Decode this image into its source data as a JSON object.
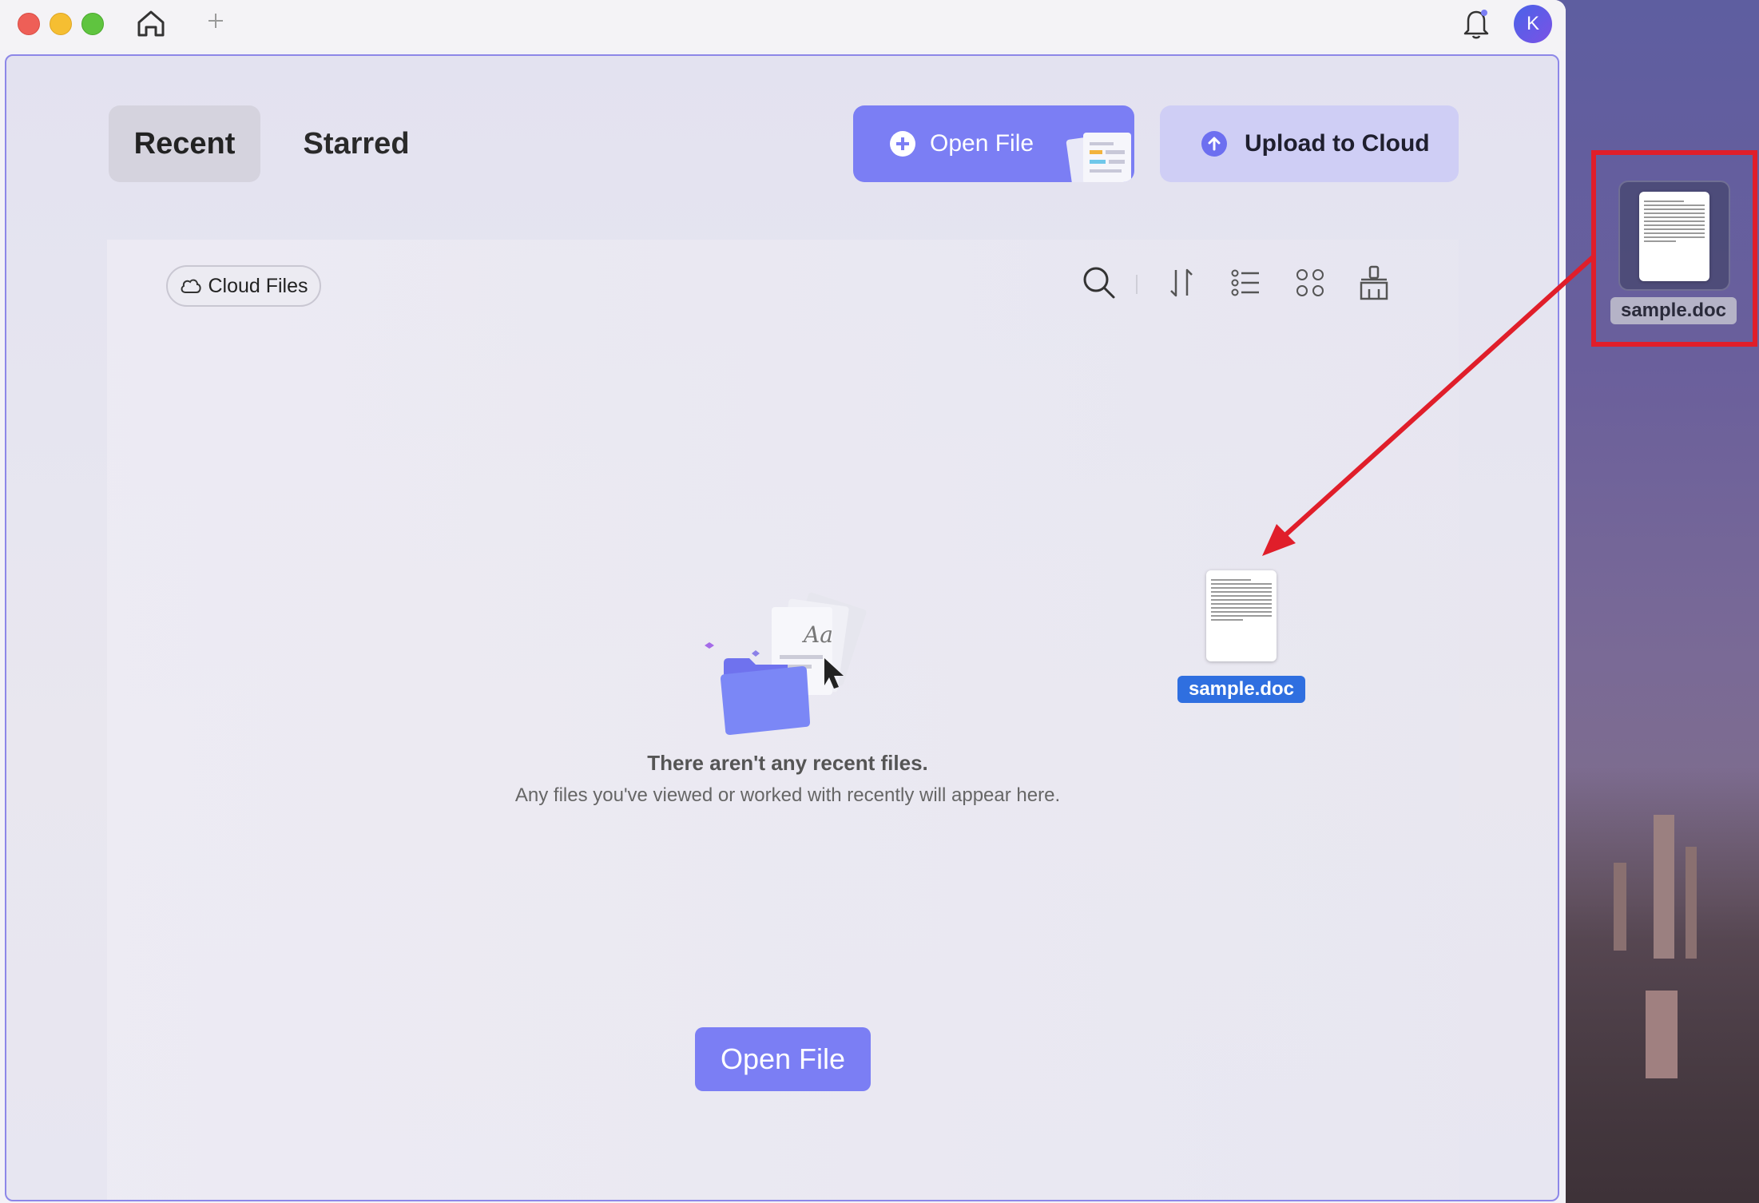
{
  "titlebar": {
    "avatar_letter": "K"
  },
  "tabs": [
    {
      "label": "Recent",
      "active": true
    },
    {
      "label": "Starred",
      "active": false
    }
  ],
  "actions": {
    "open_file_label": "Open File",
    "upload_label": "Upload to Cloud"
  },
  "filters": {
    "cloud_files_label": "Cloud Files"
  },
  "empty_state": {
    "title": "There aren't any recent files.",
    "subtitle": "Any files you've viewed or worked with recently will appear here.",
    "button_label": "Open File"
  },
  "drag_file": {
    "name": "sample.doc"
  },
  "desktop_file": {
    "name": "sample.doc"
  },
  "colors": {
    "accent": "#7b7ef4",
    "upload_bg": "#cfcef5",
    "highlight": "#e01e2a",
    "selection": "#2f6fe0"
  }
}
